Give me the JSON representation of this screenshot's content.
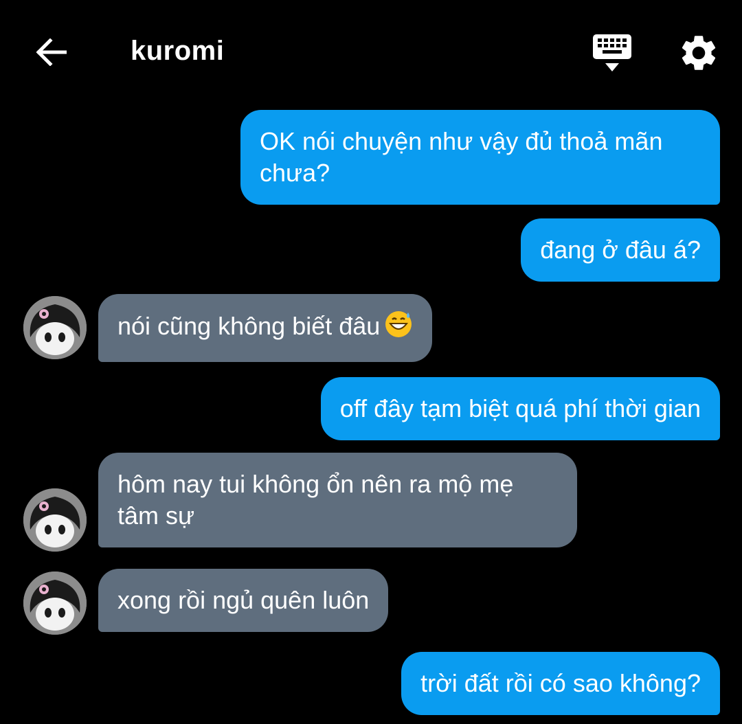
{
  "header": {
    "title": "kuromi",
    "back_icon": "arrow-left-icon",
    "keyboard_icon": "keyboard-hide-icon",
    "settings_icon": "gear-icon"
  },
  "colors": {
    "background": "#000000",
    "sent_bubble": "#0a9cf0",
    "received_bubble": "#5f6e7e",
    "text": "#ffffff"
  },
  "messages": [
    {
      "sender": "me",
      "text": "OK nói chuyện như vậy đủ thoả mãn chưa?"
    },
    {
      "sender": "me",
      "text": "đang ở đâu á?"
    },
    {
      "sender": "kuromi",
      "text": "nói cũng không biết đâu",
      "emoji": "grinning-face-with-sweat"
    },
    {
      "sender": "me",
      "text": "off đây tạm biệt quá phí thời gian"
    },
    {
      "sender": "kuromi",
      "text": "hôm nay tui không ổn nên ra mộ mẹ tâm sự"
    },
    {
      "sender": "kuromi",
      "text": "xong rồi ngủ quên luôn"
    },
    {
      "sender": "me",
      "text": "trời đất rồi có sao không?"
    }
  ]
}
